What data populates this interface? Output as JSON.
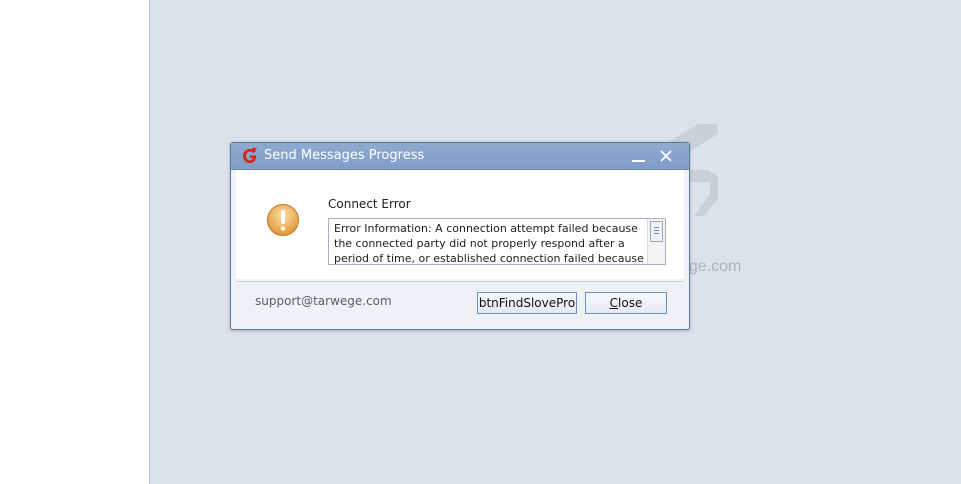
{
  "background": {
    "watermark_text": "ege.com"
  },
  "dialog": {
    "title": "Send Messages Progress",
    "heading": "Connect Error",
    "message": "Error Information: A connection attempt failed because the connected party did not properly respond after a period of time, or established connection failed because connected",
    "footer_text": "support@tarwege.com",
    "find_button_label": "btnFindSlovePro",
    "close_button_mnemonic": "C",
    "close_button_rest": "lose"
  },
  "colors": {
    "titlebar": "#7f9ec6",
    "desktop": "#dce2e9",
    "accent_button_border": "#6c8fbc",
    "warning_icon": "#e7a94d"
  },
  "icons": {
    "app": "app-logo-icon",
    "warning": "warning-icon",
    "minimize": "minimize-icon",
    "close": "close-icon"
  }
}
